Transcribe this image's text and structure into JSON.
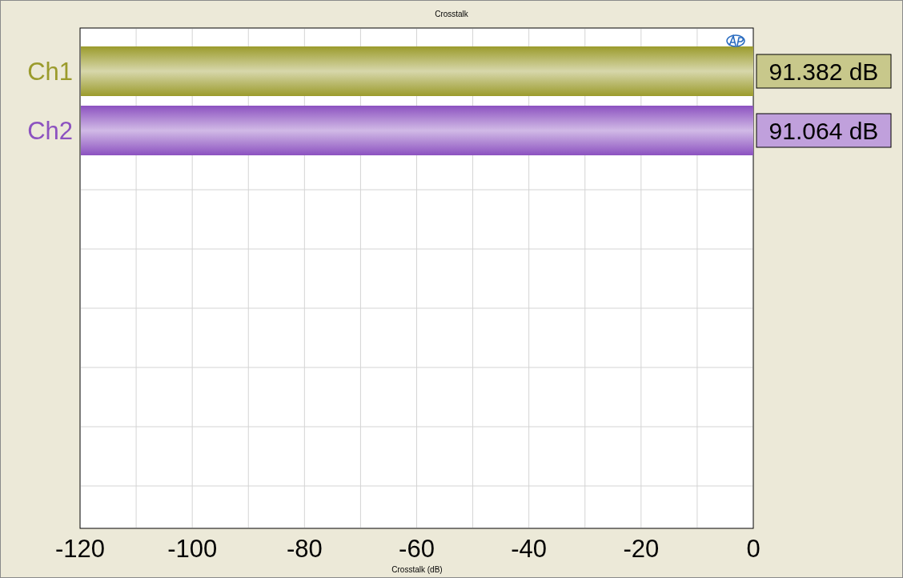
{
  "graph": {
    "title": "Crosstalk",
    "x_axis_title": "Crosstalk (dB)",
    "x_tick_labels": [
      "-120",
      "-100",
      "-80",
      "-60",
      "-40",
      "-20",
      "0"
    ],
    "channels": [
      {
        "name": "Ch1",
        "color": "#9b9b2c",
        "reading": "91.382 dB"
      },
      {
        "name": "Ch2",
        "color": "#8c52c0",
        "reading": "91.064 dB"
      }
    ]
  }
}
